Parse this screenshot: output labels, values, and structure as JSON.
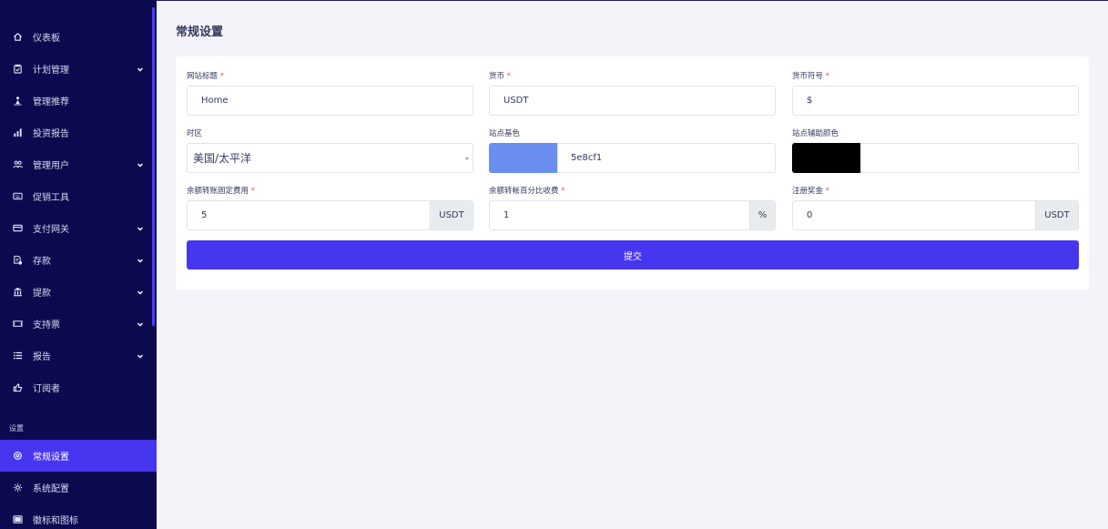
{
  "sidebar": {
    "items": [
      {
        "label": "仪表板",
        "icon": "home-icon"
      },
      {
        "label": "计划管理",
        "icon": "clipboard-icon",
        "has_children": true
      },
      {
        "label": "管理推荐",
        "icon": "user-tree-icon"
      },
      {
        "label": "投资报告",
        "icon": "bar-chart-icon"
      },
      {
        "label": "管理用户",
        "icon": "users-icon",
        "has_children": true
      },
      {
        "label": "促销工具",
        "icon": "keyboard-icon"
      },
      {
        "label": "支付网关",
        "icon": "credit-card-icon",
        "has_children": true
      },
      {
        "label": "存款",
        "icon": "deposit-icon",
        "has_children": true
      },
      {
        "label": "提款",
        "icon": "bank-icon",
        "has_children": true
      },
      {
        "label": "支持票",
        "icon": "ticket-icon",
        "has_children": true
      },
      {
        "label": "报告",
        "icon": "list-icon",
        "has_children": true
      },
      {
        "label": "订阅者",
        "icon": "thumbs-up-icon"
      }
    ],
    "section_label": "设置",
    "settings_items": [
      {
        "label": "常规设置",
        "icon": "settings-circle-icon",
        "active": true
      },
      {
        "label": "系统配置",
        "icon": "gear-icon"
      },
      {
        "label": "徽标和图标",
        "icon": "image-icon"
      }
    ]
  },
  "page": {
    "title": "常规设置"
  },
  "form": {
    "site_title": {
      "label": "网站标题",
      "value": "Home",
      "required": "*"
    },
    "currency": {
      "label": "货币",
      "value": "USDT",
      "required": "*"
    },
    "currency_symbol": {
      "label": "货币符号",
      "value": "$",
      "required": "*"
    },
    "timezone": {
      "label": "时区",
      "value": "美国/太平洋"
    },
    "base_color": {
      "label": "站点基色",
      "value": "5e8cf1",
      "swatch": "#6a8df0"
    },
    "secondary_color": {
      "label": "站点辅助颜色",
      "value": "",
      "swatch": "#000000"
    },
    "fixed_fee": {
      "label": "余额转账固定费用",
      "value": "5",
      "addon": "USDT",
      "required": "*"
    },
    "percent_fee": {
      "label": "余额转帐百分比收费",
      "value": "1",
      "addon": "%",
      "required": "*"
    },
    "signup_bonus": {
      "label": "注册奖金",
      "value": "0",
      "addon": "USDT",
      "required": "*"
    },
    "submit_label": "提交"
  },
  "colors": {
    "sidebar_bg": "#0c0a4f",
    "accent": "#4736f0",
    "page_bg": "#f3f3f9"
  }
}
